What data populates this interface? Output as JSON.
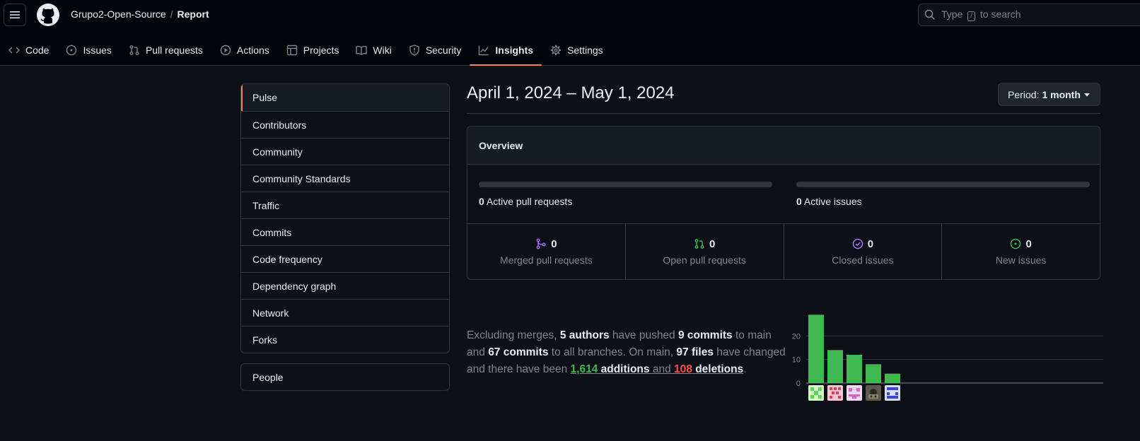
{
  "header": {
    "owner": "Grupo2-Open-Source",
    "separator": "/",
    "repo": "Report",
    "search_prefix": "Type",
    "search_key": "/",
    "search_suffix": "to search"
  },
  "tabs": [
    {
      "label": "Code",
      "icon": "code-icon"
    },
    {
      "label": "Issues",
      "icon": "issue-icon"
    },
    {
      "label": "Pull requests",
      "icon": "pull-request-icon"
    },
    {
      "label": "Actions",
      "icon": "play-icon"
    },
    {
      "label": "Projects",
      "icon": "table-icon"
    },
    {
      "label": "Wiki",
      "icon": "book-icon"
    },
    {
      "label": "Security",
      "icon": "shield-icon"
    },
    {
      "label": "Insights",
      "icon": "graph-icon",
      "active": true
    },
    {
      "label": "Settings",
      "icon": "gear-icon"
    }
  ],
  "sidebar": {
    "items": [
      "Pulse",
      "Contributors",
      "Community",
      "Community Standards",
      "Traffic",
      "Commits",
      "Code frequency",
      "Dependency graph",
      "Network",
      "Forks"
    ],
    "active": "Pulse",
    "people": "People"
  },
  "main": {
    "title": "April 1, 2024 – May 1, 2024",
    "period_label": "Period:",
    "period_value": "1 month",
    "overview": {
      "heading": "Overview",
      "active_prs": {
        "count": "0",
        "label": "Active pull requests",
        "fill": 0
      },
      "active_issues": {
        "count": "0",
        "label": "Active issues",
        "fill": 0
      },
      "stats": [
        {
          "count": "0",
          "label": "Merged pull requests",
          "icon": "merge-icon",
          "color": "#a371f7"
        },
        {
          "count": "0",
          "label": "Open pull requests",
          "icon": "pull-request-icon",
          "color": "#3fb950"
        },
        {
          "count": "0",
          "label": "Closed issues",
          "icon": "issue-closed-icon",
          "color": "#a371f7"
        },
        {
          "count": "0",
          "label": "New issues",
          "icon": "issue-opened-icon",
          "color": "#3fb950"
        }
      ]
    },
    "summary": {
      "p1": "Excluding merges,",
      "authors": "5 authors",
      "p2": "have pushed",
      "commits_main": "9 commits",
      "p3": "to main and",
      "commits_all": "67 commits",
      "p4": "to all branches. On main,",
      "files": "97 files",
      "p5": "have changed and there have been",
      "additions_num": "1,614",
      "additions_word": "additions",
      "p6": "and",
      "deletions_num": "108",
      "deletions_word": "deletions",
      "p7": "."
    }
  },
  "chart_data": {
    "type": "bar",
    "categories": [
      "author-1",
      "author-2",
      "author-3",
      "author-4",
      "author-5"
    ],
    "values": [
      29,
      14,
      12,
      8,
      4
    ],
    "ylim": [
      0,
      30
    ],
    "yticks": [
      "0",
      "10",
      "20"
    ],
    "grid": true,
    "bar_color": "#3fb950"
  }
}
